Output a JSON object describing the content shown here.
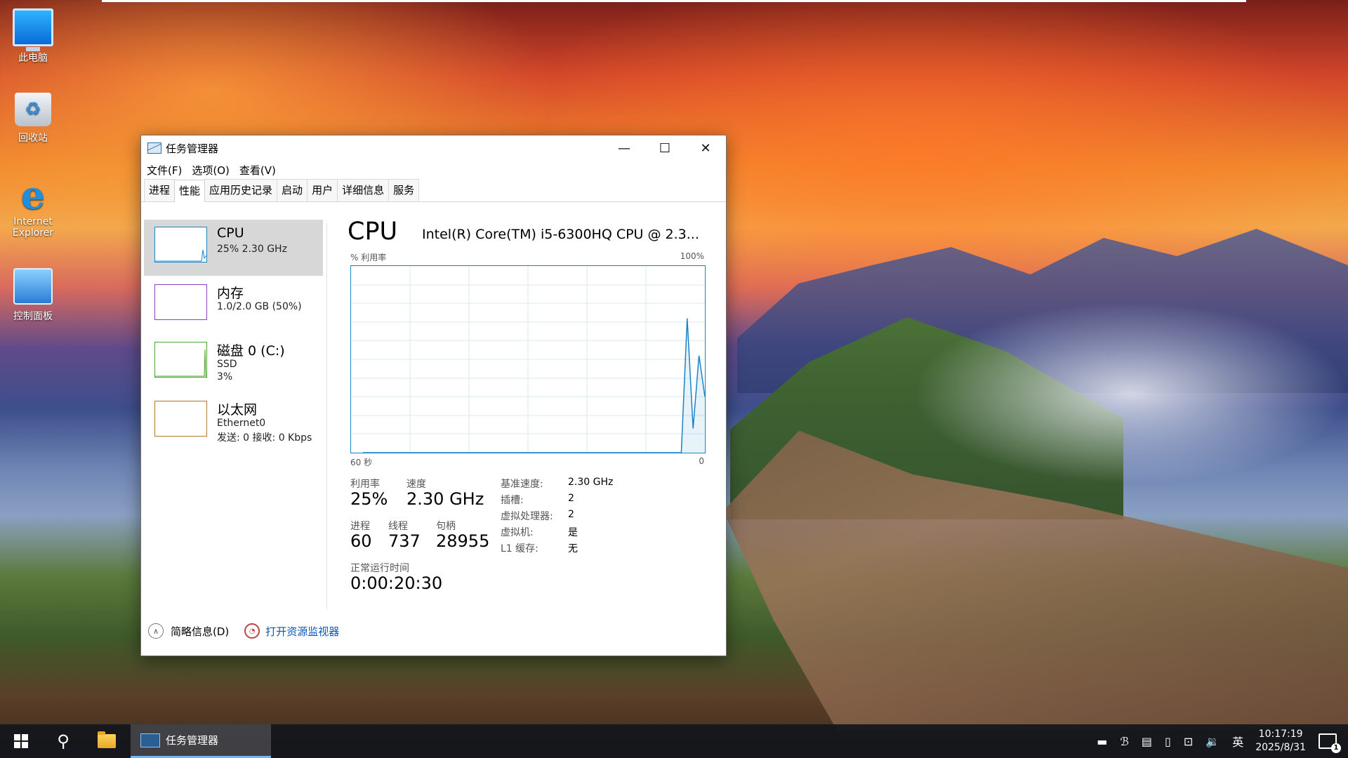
{
  "desktop": {
    "icons": [
      {
        "label": "此电脑",
        "icon": "computer-icon"
      },
      {
        "label": "回收站",
        "icon": "recycle-bin-icon"
      },
      {
        "label": "Internet Explorer",
        "icon": "internet-explorer-icon"
      },
      {
        "label": "控制面板",
        "icon": "control-panel-icon"
      }
    ]
  },
  "window": {
    "title": "任务管理器",
    "controls": {
      "minimize": "—",
      "maximize": "☐",
      "close": "✕"
    },
    "menu": [
      "文件(F)",
      "选项(O)",
      "查看(V)"
    ],
    "tabs": [
      "进程",
      "性能",
      "应用历史记录",
      "启动",
      "用户",
      "详细信息",
      "服务"
    ],
    "active_tab": "性能",
    "resources": [
      {
        "name": "CPU",
        "line1": "25% 2.30 GHz",
        "selected": true,
        "color": "#1b84c5"
      },
      {
        "name": "内存",
        "line1": "1.0/2.0 GB (50%)",
        "color": "#8b3fbe"
      },
      {
        "name": "磁盘 0 (C:)",
        "line1": "SSD",
        "line2": "3%",
        "color": "#4da330"
      },
      {
        "name": "以太网",
        "line1": "Ethernet0",
        "line2": "发送: 0 接收: 0 Kbps",
        "color": "#b07c2a"
      }
    ],
    "detail": {
      "title": "CPU",
      "cpu_name": "Intel(R) Core(TM) i5-6300HQ CPU @ 2.3...",
      "graph_label_left": "% 利用率",
      "graph_label_right": "100%",
      "graph_bottom_left": "60 秒",
      "graph_bottom_right": "0",
      "utilization_label": "利用率",
      "utilization": "25%",
      "speed_label": "速度",
      "speed": "2.30 GHz",
      "processes_label": "进程",
      "processes": "60",
      "threads_label": "线程",
      "threads": "737",
      "handles_label": "句柄",
      "handles": "28955",
      "uptime_label": "正常运行时间",
      "uptime": "0:00:20:30",
      "info": [
        {
          "label": "基准速度:",
          "value": "2.30 GHz"
        },
        {
          "label": "插槽:",
          "value": "2"
        },
        {
          "label": "虚拟处理器:",
          "value": "2"
        },
        {
          "label": "虚拟机:",
          "value": "是"
        },
        {
          "label": "L1 缓存:",
          "value": "无"
        }
      ],
      "series_percent": [
        0,
        0,
        0,
        0,
        0,
        0,
        0,
        0,
        0,
        0,
        0,
        0,
        0,
        0,
        0,
        0,
        0,
        0,
        0,
        0,
        0,
        0,
        0,
        0,
        0,
        0,
        0,
        0,
        0,
        0,
        0,
        0,
        0,
        0,
        0,
        0,
        0,
        0,
        0,
        0,
        0,
        0,
        0,
        0,
        0,
        0,
        0,
        0,
        0,
        0,
        0,
        0,
        0,
        0,
        0,
        72,
        13,
        52,
        30
      ]
    },
    "bottom": {
      "fewer_details": "简略信息(D)",
      "open_monitor": "打开资源监视器"
    }
  },
  "taskbar": {
    "task_label": "任务管理器",
    "ime": "英",
    "time": "10:17:19",
    "date": "2025/8/31",
    "notif_count": "1"
  }
}
